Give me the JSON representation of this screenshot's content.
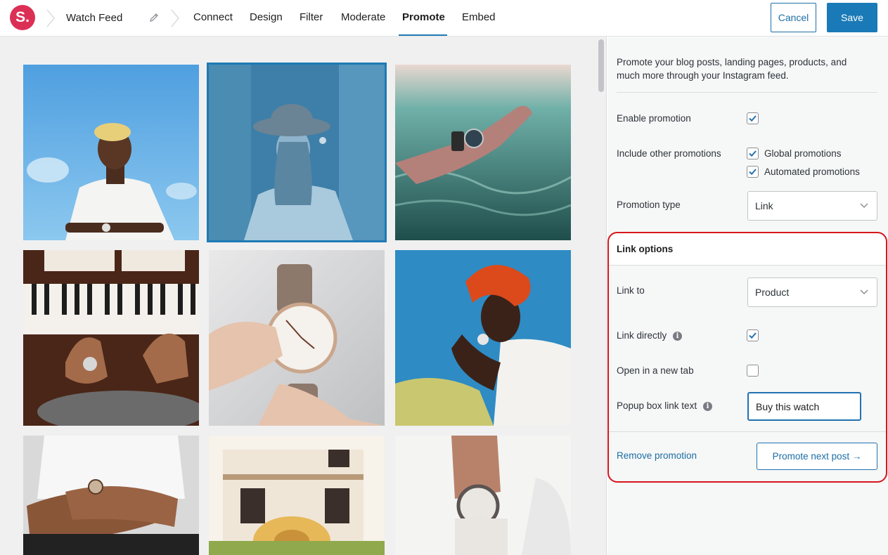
{
  "header": {
    "logo_text": "S.",
    "feed_name": "Watch Feed",
    "tabs": [
      {
        "label": "Connect"
      },
      {
        "label": "Design"
      },
      {
        "label": "Filter"
      },
      {
        "label": "Moderate"
      },
      {
        "label": "Promote",
        "active": true
      },
      {
        "label": "Embed"
      }
    ],
    "cancel_label": "Cancel",
    "save_label": "Save"
  },
  "grid": {
    "posts": [
      {
        "subject": "man in white shirt against blue sky",
        "selected": false
      },
      {
        "subject": "woman in hat",
        "selected": true
      },
      {
        "subject": "hand with watch in water",
        "selected": false
      },
      {
        "subject": "hands playing piano",
        "selected": false
      },
      {
        "subject": "hand holding watch",
        "selected": false
      },
      {
        "subject": "woman with red headwrap",
        "selected": false
      },
      {
        "subject": "crossed arms with watch",
        "selected": false
      },
      {
        "subject": "white building with hat",
        "selected": false
      },
      {
        "subject": "wrist watch with sweater",
        "selected": false
      }
    ]
  },
  "panel": {
    "intro": "Promote your blog posts, landing pages, products, and much more through your Instagram feed.",
    "enable_promotion_label": "Enable promotion",
    "enable_promotion_checked": true,
    "include_other_label": "Include other promotions",
    "global_promotions_label": "Global promotions",
    "global_promotions_checked": true,
    "automated_promotions_label": "Automated promotions",
    "automated_promotions_checked": true,
    "promotion_type_label": "Promotion type",
    "promotion_type_value": "Link",
    "link_options": {
      "title": "Link options",
      "link_to_label": "Link to",
      "link_to_value": "Product",
      "link_directly_label": "Link directly",
      "link_directly_checked": true,
      "new_tab_label": "Open in a new tab",
      "new_tab_checked": false,
      "popup_text_label": "Popup box link text",
      "popup_text_value": "Buy this watch",
      "remove_label": "Remove promotion",
      "next_label": "Promote next post →"
    }
  },
  "colors": {
    "brand": "#dc2f55",
    "accent": "#1a7ab7",
    "highlight": "#d6171d"
  }
}
